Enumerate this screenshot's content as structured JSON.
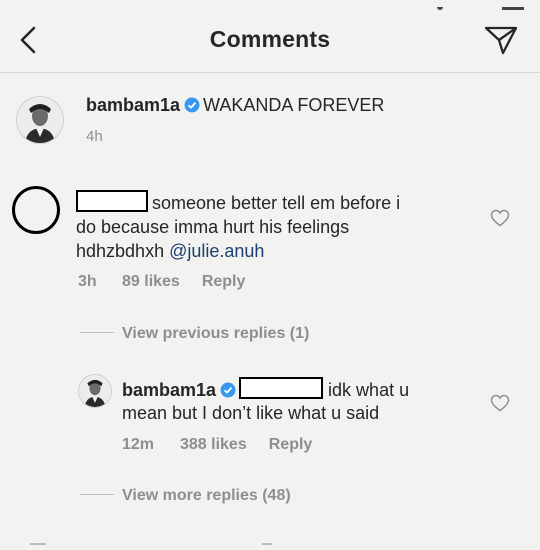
{
  "header": {
    "title": "Comments",
    "back_icon": "chevron-left-icon",
    "send_icon": "paper-plane-icon"
  },
  "post": {
    "username": "bambam1a",
    "caption": "WAKANDA FOREVER",
    "time": "4h"
  },
  "comment": {
    "text_line1": "someone better tell em before i",
    "text_line2": "do because imma hurt his feelings",
    "text_line3": "hdhzbdhxh ",
    "mention": "@julie.anuh",
    "time": "3h",
    "likes": "89 likes",
    "reply": "Reply"
  },
  "view_previous_replies": "View previous replies (1)",
  "reply": {
    "username": "bambam1a",
    "text_line1": "idk what u",
    "text_line2": "mean but I don’t like what u said",
    "time": "12m",
    "likes": "388 likes",
    "reply": "Reply"
  },
  "view_more_replies": "View more replies (48)",
  "colors": {
    "background": "#f2f2f0",
    "text": "#262626",
    "muted": "#8e8e8e",
    "verified": "#3897f0",
    "mention": "#1d3f6e"
  }
}
